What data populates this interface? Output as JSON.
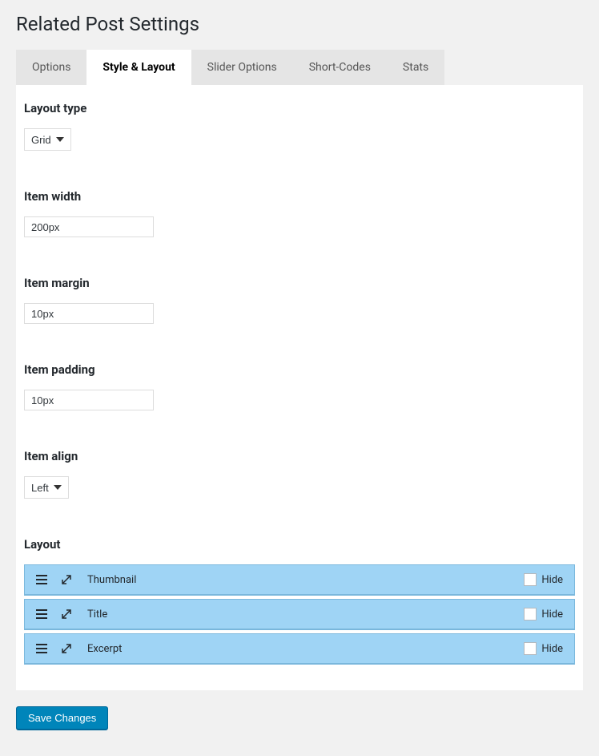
{
  "page": {
    "title": "Related Post Settings"
  },
  "tabs": [
    {
      "label": "Options"
    },
    {
      "label": "Style & Layout"
    },
    {
      "label": "Slider Options"
    },
    {
      "label": "Short-Codes"
    },
    {
      "label": "Stats"
    }
  ],
  "fields": {
    "layout_type": {
      "label": "Layout type",
      "value": "Grid"
    },
    "item_width": {
      "label": "Item width",
      "value": "200px"
    },
    "item_margin": {
      "label": "Item margin",
      "value": "10px"
    },
    "item_padding": {
      "label": "Item padding",
      "value": "10px"
    },
    "item_align": {
      "label": "Item align",
      "value": "Left"
    },
    "layout": {
      "label": "Layout"
    }
  },
  "layout_items": [
    {
      "label": "Thumbnail",
      "hide_label": "Hide"
    },
    {
      "label": "Title",
      "hide_label": "Hide"
    },
    {
      "label": "Excerpt",
      "hide_label": "Hide"
    }
  ],
  "buttons": {
    "save": "Save Changes"
  }
}
